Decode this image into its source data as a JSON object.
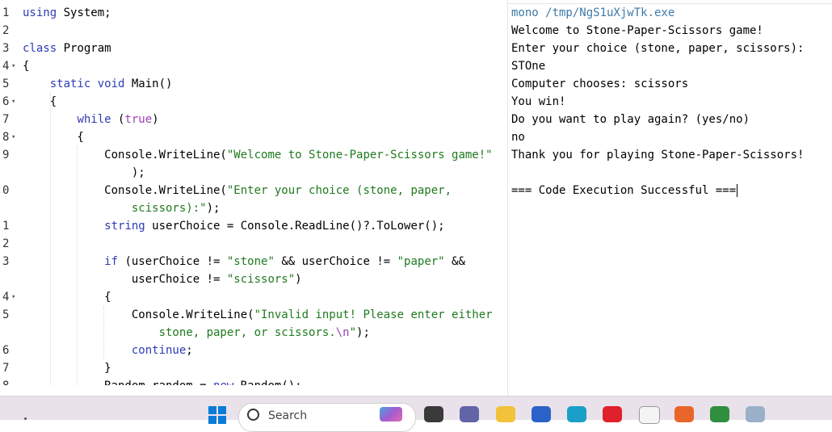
{
  "editor": {
    "lines": [
      {
        "num": "1",
        "fold": "",
        "tokens": [
          {
            "t": "using",
            "c": "kw"
          },
          {
            "t": " System;"
          }
        ]
      },
      {
        "num": "2",
        "fold": "",
        "tokens": []
      },
      {
        "num": "3",
        "fold": "",
        "tokens": [
          {
            "t": "class",
            "c": "kw"
          },
          {
            "t": " Program"
          }
        ]
      },
      {
        "num": "4",
        "fold": "▾",
        "tokens": [
          {
            "t": "{"
          }
        ]
      },
      {
        "num": "5",
        "fold": "",
        "tokens": [
          {
            "t": "    "
          },
          {
            "t": "static",
            "c": "kw"
          },
          {
            "t": " "
          },
          {
            "t": "void",
            "c": "kw"
          },
          {
            "t": " Main()"
          }
        ]
      },
      {
        "num": "6",
        "fold": "▾",
        "tokens": [
          {
            "t": "    {"
          }
        ]
      },
      {
        "num": "7",
        "fold": "",
        "tokens": [
          {
            "t": "        "
          },
          {
            "t": "while",
            "c": "kw"
          },
          {
            "t": " ("
          },
          {
            "t": "true",
            "c": "lit"
          },
          {
            "t": ")"
          }
        ]
      },
      {
        "num": "8",
        "fold": "▾",
        "tokens": [
          {
            "t": "        {"
          }
        ]
      },
      {
        "num": "9",
        "fold": "",
        "tokens": [
          {
            "t": "            Console.WriteLine("
          },
          {
            "t": "\"Welcome to Stone-Paper-Scissors game!\"",
            "c": "str"
          }
        ]
      },
      {
        "num": "",
        "fold": "",
        "tokens": [
          {
            "t": "                );"
          }
        ]
      },
      {
        "num": "0",
        "fold": "",
        "tokens": [
          {
            "t": "            Console.WriteLine("
          },
          {
            "t": "\"Enter your choice (stone, paper,",
            "c": "str"
          }
        ]
      },
      {
        "num": "",
        "fold": "",
        "tokens": [
          {
            "t": "                "
          },
          {
            "t": "scissors):\"",
            "c": "str"
          },
          {
            "t": ");"
          }
        ]
      },
      {
        "num": "1",
        "fold": "",
        "tokens": [
          {
            "t": "            "
          },
          {
            "t": "string",
            "c": "kw"
          },
          {
            "t": " userChoice = Console.ReadLine()?.ToLower();"
          }
        ]
      },
      {
        "num": "2",
        "fold": "",
        "tokens": []
      },
      {
        "num": "3",
        "fold": "",
        "tokens": [
          {
            "t": "            "
          },
          {
            "t": "if",
            "c": "kw"
          },
          {
            "t": " (userChoice != "
          },
          {
            "t": "\"stone\"",
            "c": "str"
          },
          {
            "t": " && userChoice != "
          },
          {
            "t": "\"paper\"",
            "c": "str"
          },
          {
            "t": " &&"
          }
        ]
      },
      {
        "num": "",
        "fold": "",
        "tokens": [
          {
            "t": "                userChoice != "
          },
          {
            "t": "\"scissors\"",
            "c": "str"
          },
          {
            "t": ")"
          }
        ]
      },
      {
        "num": "4",
        "fold": "▾",
        "tokens": [
          {
            "t": "            {"
          }
        ]
      },
      {
        "num": "5",
        "fold": "",
        "tokens": [
          {
            "t": "                Console.WriteLine("
          },
          {
            "t": "\"Invalid input! Please enter either",
            "c": "str"
          }
        ]
      },
      {
        "num": "",
        "fold": "",
        "tokens": [
          {
            "t": "                    "
          },
          {
            "t": "stone, paper, or scissors.",
            "c": "str"
          },
          {
            "t": "\\n",
            "c": "lit"
          },
          {
            "t": "\"",
            "c": "str"
          },
          {
            "t": ");"
          }
        ]
      },
      {
        "num": "6",
        "fold": "",
        "tokens": [
          {
            "t": "                "
          },
          {
            "t": "continue",
            "c": "kw"
          },
          {
            "t": ";"
          }
        ]
      },
      {
        "num": "7",
        "fold": "",
        "tokens": [
          {
            "t": "            }"
          }
        ]
      },
      {
        "num": "8",
        "fold": "",
        "tokens": [
          {
            "t": "            Random random = "
          },
          {
            "t": "new",
            "c": "kw"
          },
          {
            "t": " Random();"
          }
        ]
      }
    ]
  },
  "console": {
    "lines": [
      {
        "text": "mono /tmp/NgS1uXjwTk.exe",
        "kind": "cmd"
      },
      {
        "text": "Welcome to Stone-Paper-Scissors game!"
      },
      {
        "text": "Enter your choice (stone, paper, scissors):"
      },
      {
        "text": "STOne"
      },
      {
        "text": "Computer chooses: scissors"
      },
      {
        "text": "You win!"
      },
      {
        "text": "Do you want to play again? (yes/no)"
      },
      {
        "text": "no"
      },
      {
        "text": "Thank you for playing Stone-Paper-Scissors!"
      },
      {
        "text": ""
      },
      {
        "text": "=== Code Execution Successful ==="
      }
    ]
  },
  "taskbar": {
    "search_placeholder": "Search",
    "icons": [
      {
        "name": "task-view-icon",
        "color": "#3a3a3a"
      },
      {
        "name": "teams-icon",
        "color": "#6264a7"
      },
      {
        "name": "file-explorer-icon",
        "color": "#f2c23a"
      },
      {
        "name": "store-icon",
        "color": "#2a62c9"
      },
      {
        "name": "edge-icon",
        "color": "#1aa0c8"
      },
      {
        "name": "opera-icon",
        "color": "#e0202a"
      },
      {
        "name": "document-icon",
        "color": "#f4f4f4"
      },
      {
        "name": "firefox-icon",
        "color": "#e8662a"
      },
      {
        "name": "mongodb-icon",
        "color": "#2f8f3e"
      },
      {
        "name": "notepad-icon",
        "color": "#9ab0c8"
      }
    ]
  }
}
